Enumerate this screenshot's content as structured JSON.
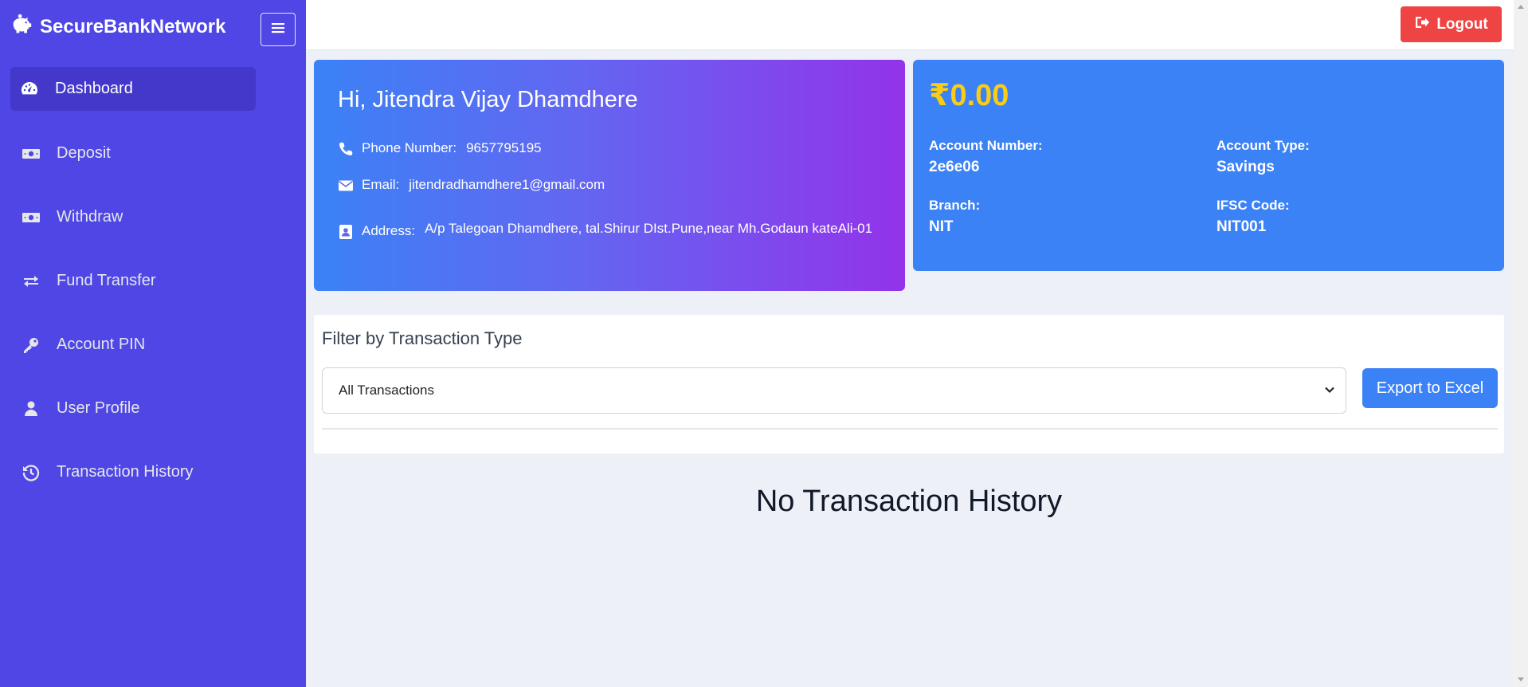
{
  "brand": {
    "name": "SecureBankNetwork",
    "icon": "piggy-bank-icon"
  },
  "sidebar": {
    "items": [
      {
        "label": "Dashboard",
        "icon": "gauge-icon",
        "active": true
      },
      {
        "label": "Deposit",
        "icon": "money-bill-icon"
      },
      {
        "label": "Withdraw",
        "icon": "money-bill-icon"
      },
      {
        "label": "Fund Transfer",
        "icon": "exchange-icon"
      },
      {
        "label": "Account PIN",
        "icon": "key-icon"
      },
      {
        "label": "User Profile",
        "icon": "user-icon"
      },
      {
        "label": "Transaction History",
        "icon": "history-icon"
      }
    ]
  },
  "topbar": {
    "logout_label": "Logout"
  },
  "profile": {
    "greeting": "Hi, Jitendra Vijay Dhamdhere",
    "phone_label": "Phone Number:",
    "phone": "9657795195",
    "email_label": "Email:",
    "email": "jitendradhamdhere1@gmail.com",
    "address_label": "Address:",
    "address": "A/p Talegoan Dhamdhere, tal.Shirur DIst.Pune,near Mh.Godaun kateAli-01"
  },
  "account": {
    "balance": "₹0.00",
    "number_label": "Account Number:",
    "number": "2e6e06",
    "type_label": "Account Type:",
    "type": "Savings",
    "branch_label": "Branch:",
    "branch": "NIT",
    "ifsc_label": "IFSC Code:",
    "ifsc": "NIT001"
  },
  "filter": {
    "title": "Filter by Transaction Type",
    "selected": "All Transactions",
    "export_label": "Export to Excel"
  },
  "transactions": {
    "empty_message": "No Transaction History"
  },
  "colors": {
    "sidebar": "#4f46e5",
    "sidebar_active": "#4338ca",
    "logout": "#ef4444",
    "balance_card": "#3b82f6",
    "balance_amount": "#facc15"
  }
}
